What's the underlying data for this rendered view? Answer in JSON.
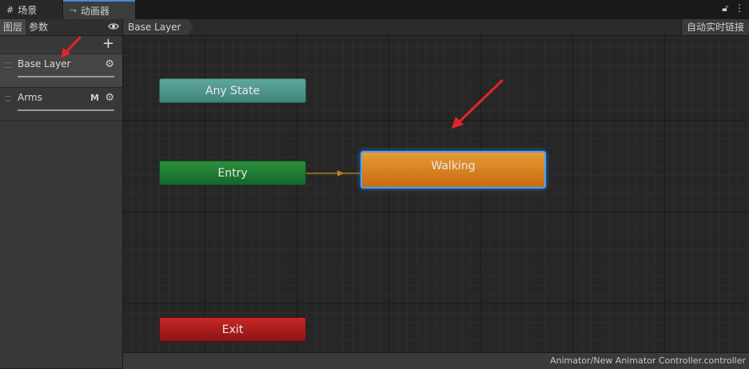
{
  "tabs": [
    {
      "label": "场景",
      "icon": "grid-icon"
    },
    {
      "label": "动画器",
      "icon": "animator-icon"
    }
  ],
  "window_controls": {
    "lock_icon": "lock-icon",
    "menu_icon": "kebab-menu-icon"
  },
  "sidebar": {
    "tabs": [
      "图层",
      "参数"
    ],
    "add_icon": "plus-icon",
    "layers": [
      {
        "name": "Base Layer",
        "badge": "",
        "weight": 1.0
      },
      {
        "name": "Arms",
        "badge": "M",
        "weight": 1.0
      }
    ]
  },
  "breadcrumb": {
    "label": "Base Layer",
    "live_link": "自动实时链接"
  },
  "graph": {
    "nodes": {
      "any_state": "Any State",
      "entry": "Entry",
      "walking": "Walking",
      "exit": "Exit"
    },
    "colors": {
      "any_state": "#4f968f",
      "entry": "#1e7a33",
      "walking": "#d9801f",
      "exit": "#a81e1e",
      "selected_outline": "#4aa3ff"
    }
  },
  "status": {
    "path": "Animator/New Animator Controller.controller"
  },
  "annotation_color": "#e8222a"
}
